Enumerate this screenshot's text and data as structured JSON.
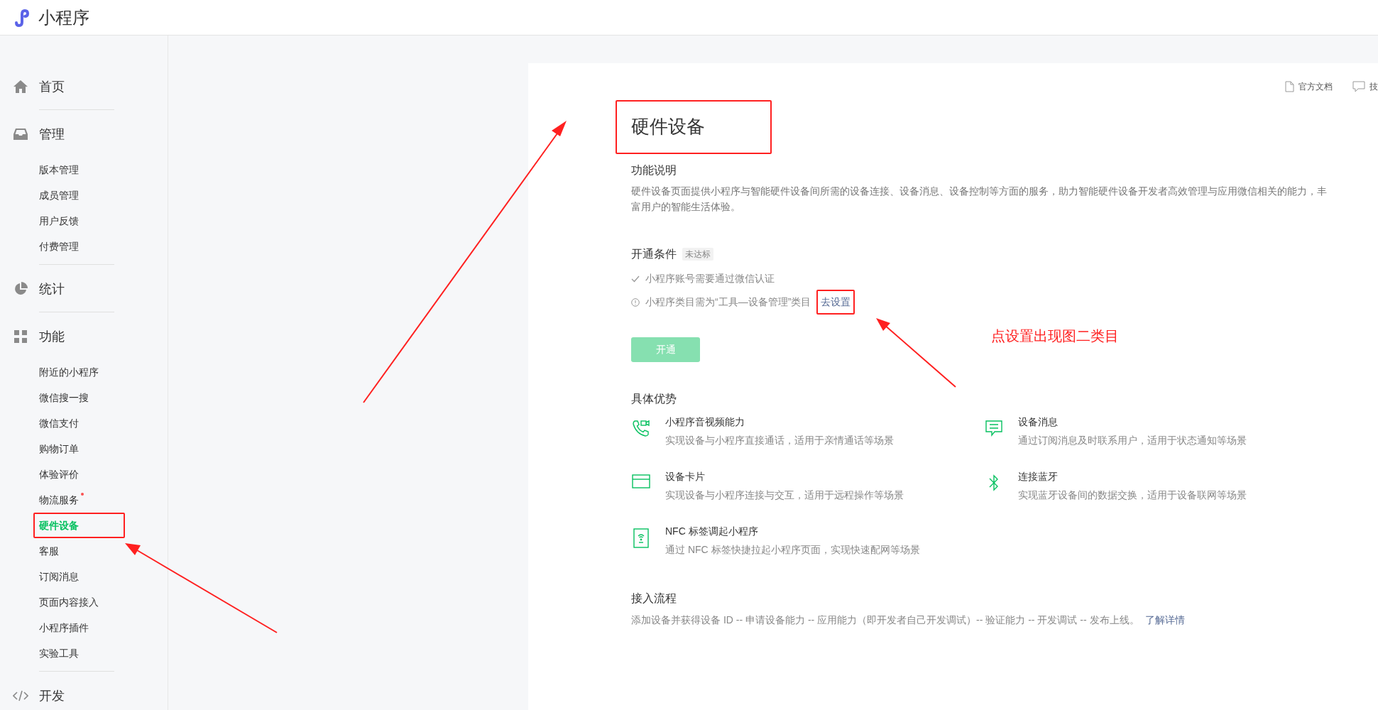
{
  "app": {
    "title": "小程序"
  },
  "sidebar": {
    "sections": [
      {
        "label": "首页"
      },
      {
        "label": "管理",
        "items": [
          {
            "label": "版本管理",
            "selected": false,
            "dot": false
          },
          {
            "label": "成员管理",
            "selected": false,
            "dot": false
          },
          {
            "label": "用户反馈",
            "selected": false,
            "dot": false
          },
          {
            "label": "付费管理",
            "selected": false,
            "dot": false
          }
        ]
      },
      {
        "label": "统计"
      },
      {
        "label": "功能",
        "items": [
          {
            "label": "附近的小程序",
            "selected": false,
            "dot": false
          },
          {
            "label": "微信搜一搜",
            "selected": false,
            "dot": false
          },
          {
            "label": "微信支付",
            "selected": false,
            "dot": false
          },
          {
            "label": "购物订单",
            "selected": false,
            "dot": false
          },
          {
            "label": "体验评价",
            "selected": false,
            "dot": false
          },
          {
            "label": "物流服务",
            "selected": false,
            "dot": true
          },
          {
            "label": "硬件设备",
            "selected": true,
            "dot": false
          },
          {
            "label": "客服",
            "selected": false,
            "dot": false
          },
          {
            "label": "订阅消息",
            "selected": false,
            "dot": false
          },
          {
            "label": "页面内容接入",
            "selected": false,
            "dot": false
          },
          {
            "label": "小程序插件",
            "selected": false,
            "dot": false
          },
          {
            "label": "实验工具",
            "selected": false,
            "dot": false
          }
        ]
      },
      {
        "label": "开发"
      }
    ]
  },
  "top_links": [
    {
      "label": "官方文档"
    },
    {
      "label": "技"
    }
  ],
  "page": {
    "title": "硬件设备",
    "intro": {
      "heading": "功能说明",
      "text": "硬件设备页面提供小程序与智能硬件设备间所需的设备连接、设备消息、设备控制等方面的服务，助力智能硬件设备开发者高效管理与应用微信相关的能力，丰富用户的智能生活体验。"
    },
    "conditions": {
      "heading": "开通条件",
      "badge": "未达标",
      "items": [
        {
          "kind": "met",
          "text": "小程序账号需要通过微信认证"
        },
        {
          "kind": "unmet",
          "text": "小程序类目需为“工具—设备管理”类目",
          "link": "去设置"
        }
      ]
    },
    "enable_button": {
      "label": "开通",
      "disabled": true
    },
    "advantages": {
      "heading": "具体优势",
      "items": [
        {
          "title": "小程序音视频能力",
          "desc": "实现设备与小程序直接通话，适用于亲情通话等场景"
        },
        {
          "title": "设备消息",
          "desc": "通过订阅消息及时联系用户，适用于状态通知等场景"
        },
        {
          "title": "设备卡片",
          "desc": "实现设备与小程序连接与交互，适用于远程操作等场景"
        },
        {
          "title": "连接蓝牙",
          "desc": "实现蓝牙设备间的数据交换，适用于设备联网等场景"
        },
        {
          "title": "NFC 标签调起小程序",
          "desc": "通过 NFC 标签快捷拉起小程序页面，实现快速配网等场景"
        }
      ]
    },
    "process": {
      "heading": "接入流程",
      "text": "添加设备并获得设备 ID -- 申请设备能力 -- 应用能力（即开发者自己开发调试）-- 验证能力 -- 开发调试 -- 发布上线。",
      "link": "了解详情"
    }
  },
  "annotation": {
    "note": "点设置出现图二类目"
  }
}
